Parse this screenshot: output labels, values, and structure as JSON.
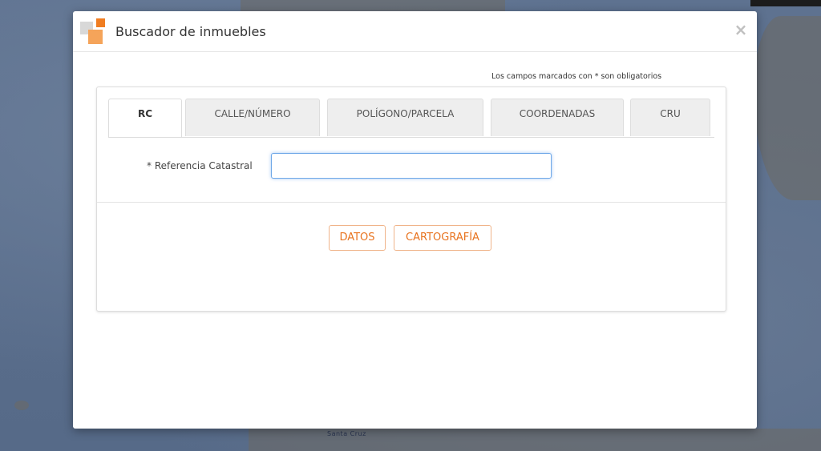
{
  "map": {
    "labels": [
      "Santa Cruz"
    ]
  },
  "modal": {
    "title": "Buscador de inmuebles",
    "close_symbol": "×",
    "required_note": "Los campos marcados con * son obligatorios"
  },
  "tabs": [
    {
      "label": "RC",
      "active": true
    },
    {
      "label": "CALLE/NÚMERO",
      "active": false
    },
    {
      "label": "POLÍGONO/PARCELA",
      "active": false
    },
    {
      "label": "COORDENADAS",
      "active": false
    },
    {
      "label": "CRU",
      "active": false
    }
  ],
  "form": {
    "label": "* Referencia Catastral",
    "value": "",
    "placeholder": ""
  },
  "buttons": {
    "datos": "DATOS",
    "cartografia": "CARTOGRAFÍA"
  },
  "colors": {
    "accent": "#e8731f",
    "logo_orange": "#f07d22",
    "logo_light_orange": "#f5a45a",
    "input_focus": "#6fa8e8"
  }
}
